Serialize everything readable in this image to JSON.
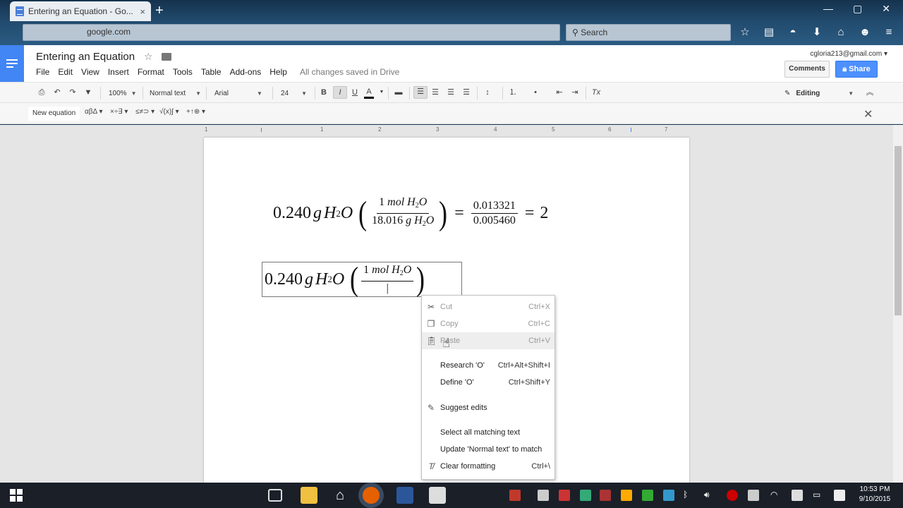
{
  "browser": {
    "tab_title": "Entering an Equation - Go...",
    "tab_close": "×",
    "new_tab": "+",
    "url_text": "google.com",
    "search_placeholder": "Search"
  },
  "docs": {
    "title": "Entering an Equation",
    "menu": [
      "File",
      "Edit",
      "View",
      "Insert",
      "Format",
      "Tools",
      "Table",
      "Add-ons",
      "Help"
    ],
    "save_status": "All changes saved in Drive",
    "account": "cgloria213@gmail.com",
    "comments_label": "Comments",
    "share_label": "Share"
  },
  "toolbar": {
    "zoom": "100%",
    "style": "Normal text",
    "font": "Arial",
    "size": "24",
    "bold": "B",
    "italic": "I",
    "underline": "U",
    "text_color": "A",
    "clear_format": "Tx",
    "mode": "Editing"
  },
  "equation_bar": {
    "new_equation": "New equation",
    "groups": [
      "αβΔ",
      "×÷∃",
      "≤≠⊃",
      "√(x)∫",
      "+↑⊕"
    ]
  },
  "ruler": {
    "marks": [
      "1",
      "1",
      "2",
      "3",
      "4",
      "5",
      "6",
      "7"
    ]
  },
  "equation1": {
    "lhs_num": "0.240",
    "unit_g": "g",
    "h": "H",
    "sub2": "2",
    "o": "O",
    "frac_top_num": "1",
    "frac_top_unit": "mol",
    "frac_bot_num": "18.016",
    "frac_bot_unit": "g",
    "eq": "=",
    "frac2_top": "0.013321",
    "frac2_bot": "0.005460",
    "result": "2"
  },
  "equation2": {
    "lhs_num": "0.240",
    "unit_g": "g",
    "h": "H",
    "sub2": "2",
    "o": "O",
    "frac_top_num": "1",
    "frac_top_unit": "mol"
  },
  "context_menu": {
    "items": [
      {
        "label": "Cut",
        "shortcut": "Ctrl+X"
      },
      {
        "label": "Copy",
        "shortcut": "Ctrl+C"
      },
      {
        "label": "Paste",
        "shortcut": "Ctrl+V"
      },
      {
        "label": "Research 'O'",
        "shortcut": "Ctrl+Alt+Shift+I"
      },
      {
        "label": "Define 'O'",
        "shortcut": "Ctrl+Shift+Y"
      },
      {
        "label": "Suggest edits",
        "shortcut": ""
      },
      {
        "label": "Select all matching text",
        "shortcut": ""
      },
      {
        "label": "Update 'Normal text' to match",
        "shortcut": ""
      },
      {
        "label": "Clear formatting",
        "shortcut": "Ctrl+\\"
      }
    ]
  },
  "taskbar": {
    "time": "10:53 PM",
    "date": "9/10/2015"
  },
  "colors": {
    "docs_blue": "#4285f4",
    "share_blue": "#4d90fe",
    "taskbar": "#1a1f28"
  }
}
